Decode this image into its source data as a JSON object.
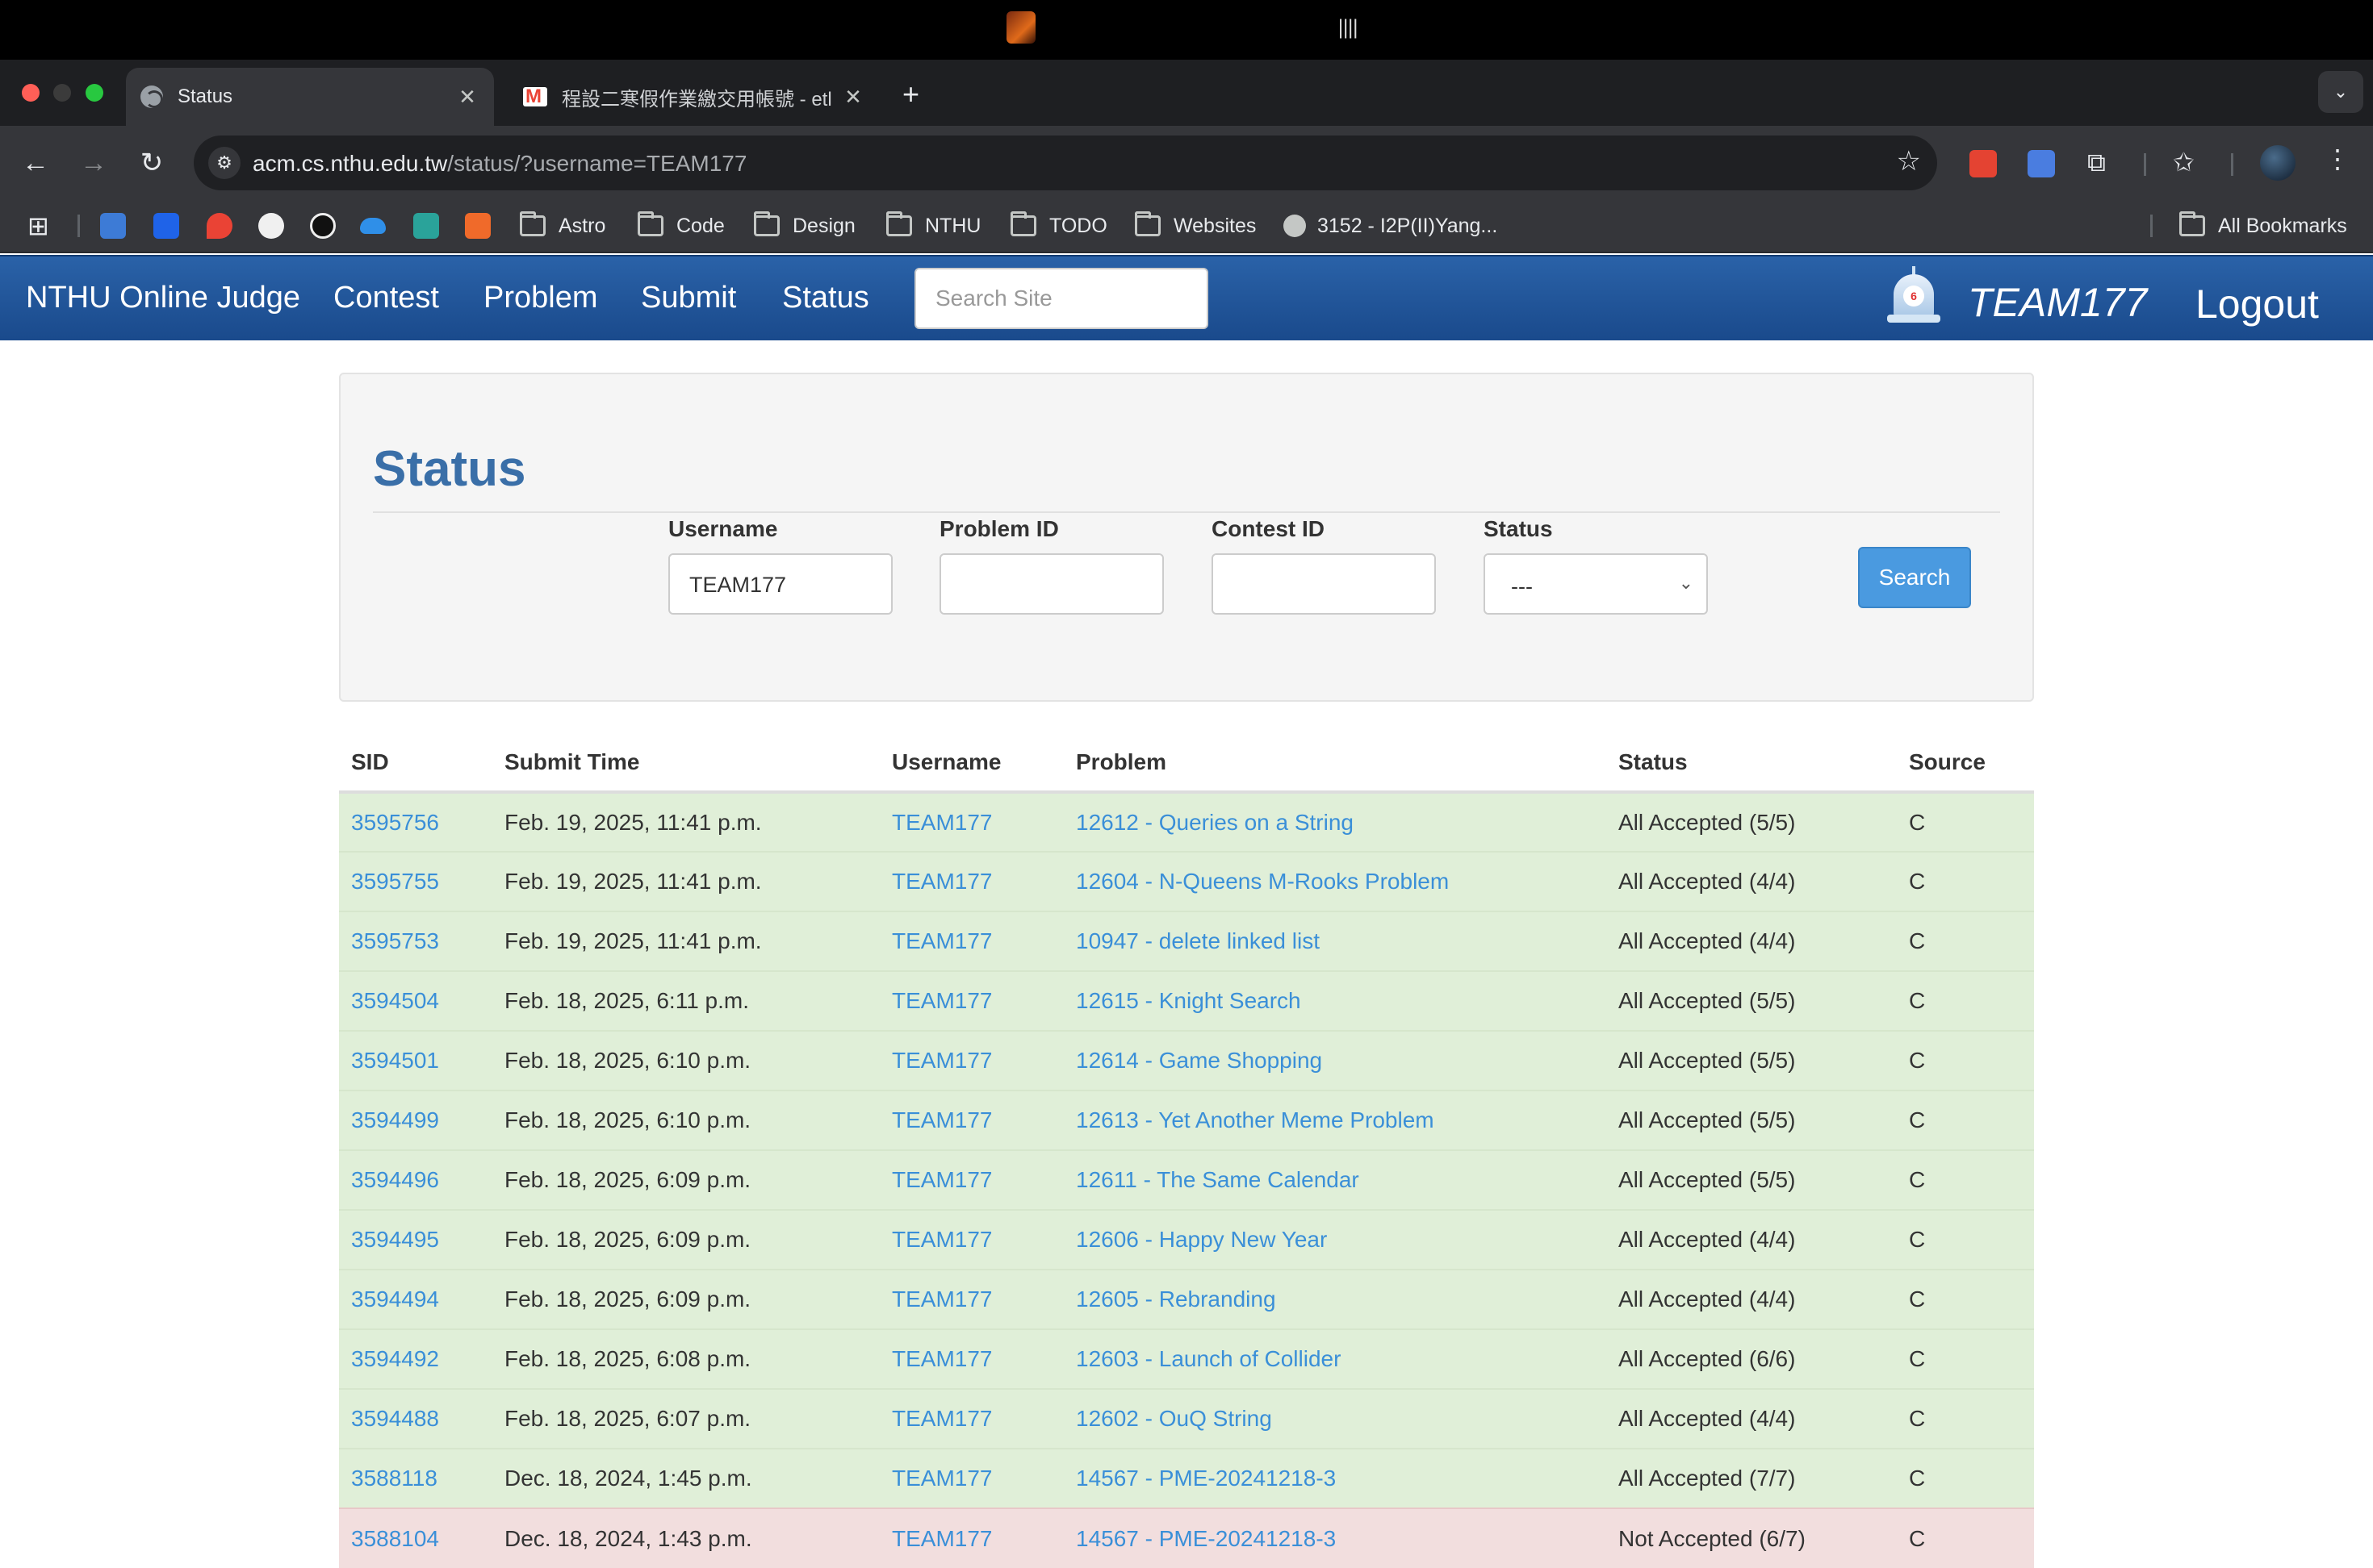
{
  "browser": {
    "tabs": [
      {
        "title": "Status"
      },
      {
        "title": "程設二寒假作業繳交用帳號 - etl"
      }
    ],
    "url_host": "acm.cs.nthu.edu.tw",
    "url_path": "/status/?username=TEAM177",
    "bookmarks": [
      "Astro",
      "Code",
      "Design",
      "NTHU",
      "TODO",
      "Websites",
      "3152 - I2P(II)Yang...",
      "All Bookmarks"
    ]
  },
  "site": {
    "brand": "NTHU Online Judge",
    "nav": [
      "Contest",
      "Problem",
      "Submit",
      "Status"
    ],
    "search_placeholder": "Search Site",
    "notification_count": "6",
    "user": "TEAM177",
    "logout": "Logout"
  },
  "filter": {
    "title": "Status",
    "username_label": "Username",
    "username_value": "TEAM177",
    "problem_label": "Problem ID",
    "problem_value": "",
    "contest_label": "Contest ID",
    "contest_value": "",
    "status_label": "Status",
    "status_value": "---",
    "search_button": "Search"
  },
  "table": {
    "headers": [
      "SID",
      "Submit Time",
      "Username",
      "Problem",
      "Status",
      "Source"
    ],
    "rows": [
      {
        "sid": "3595756",
        "time": "Feb. 19, 2025, 11:41 p.m.",
        "user": "TEAM177",
        "problem": "12612 - Queries on a String",
        "status": "All Accepted (5/5)",
        "source": "C",
        "state": "ok"
      },
      {
        "sid": "3595755",
        "time": "Feb. 19, 2025, 11:41 p.m.",
        "user": "TEAM177",
        "problem": "12604 - N-Queens M-Rooks Problem",
        "status": "All Accepted (4/4)",
        "source": "C",
        "state": "ok"
      },
      {
        "sid": "3595753",
        "time": "Feb. 19, 2025, 11:41 p.m.",
        "user": "TEAM177",
        "problem": "10947 - delete linked list",
        "status": "All Accepted (4/4)",
        "source": "C",
        "state": "ok"
      },
      {
        "sid": "3594504",
        "time": "Feb. 18, 2025, 6:11 p.m.",
        "user": "TEAM177",
        "problem": "12615 - Knight Search",
        "status": "All Accepted (5/5)",
        "source": "C",
        "state": "ok"
      },
      {
        "sid": "3594501",
        "time": "Feb. 18, 2025, 6:10 p.m.",
        "user": "TEAM177",
        "problem": "12614 - Game Shopping",
        "status": "All Accepted (5/5)",
        "source": "C",
        "state": "ok"
      },
      {
        "sid": "3594499",
        "time": "Feb. 18, 2025, 6:10 p.m.",
        "user": "TEAM177",
        "problem": "12613 - Yet Another Meme Problem",
        "status": "All Accepted (5/5)",
        "source": "C",
        "state": "ok"
      },
      {
        "sid": "3594496",
        "time": "Feb. 18, 2025, 6:09 p.m.",
        "user": "TEAM177",
        "problem": "12611 - The Same Calendar",
        "status": "All Accepted (5/5)",
        "source": "C",
        "state": "ok"
      },
      {
        "sid": "3594495",
        "time": "Feb. 18, 2025, 6:09 p.m.",
        "user": "TEAM177",
        "problem": "12606 - Happy New Year",
        "status": "All Accepted (4/4)",
        "source": "C",
        "state": "ok"
      },
      {
        "sid": "3594494",
        "time": "Feb. 18, 2025, 6:09 p.m.",
        "user": "TEAM177",
        "problem": "12605 - Rebranding",
        "status": "All Accepted (4/4)",
        "source": "C",
        "state": "ok"
      },
      {
        "sid": "3594492",
        "time": "Feb. 18, 2025, 6:08 p.m.",
        "user": "TEAM177",
        "problem": "12603 - Launch of Collider",
        "status": "All Accepted (6/6)",
        "source": "C",
        "state": "ok"
      },
      {
        "sid": "3594488",
        "time": "Feb. 18, 2025, 6:07 p.m.",
        "user": "TEAM177",
        "problem": "12602 - OuQ String",
        "status": "All Accepted (4/4)",
        "source": "C",
        "state": "ok"
      },
      {
        "sid": "3588118",
        "time": "Dec. 18, 2024, 1:45 p.m.",
        "user": "TEAM177",
        "problem": "14567 - PME-20241218-3",
        "status": "All Accepted (7/7)",
        "source": "C",
        "state": "ok"
      },
      {
        "sid": "3588104",
        "time": "Dec. 18, 2024, 1:43 p.m.",
        "user": "TEAM177",
        "problem": "14567 - PME-20241218-3",
        "status": "Not Accepted (6/7)",
        "source": "C",
        "state": "bad"
      }
    ]
  }
}
